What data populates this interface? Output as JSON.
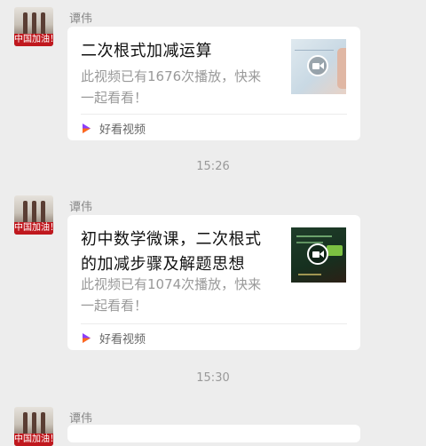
{
  "messages": [
    {
      "sender": "谭伟",
      "avatar_caption": "中国加油！",
      "card": {
        "title": "二次根式加减运算",
        "desc_line1": "此视频已有1676次播放，快来",
        "desc_line2": "一起看看！",
        "source_label": "好看视频"
      }
    },
    {
      "sender": "谭伟",
      "avatar_caption": "中国加油！",
      "card": {
        "title_line1": "初中数学微课，二次根式",
        "title_line2": "的加减步骤及解题思想",
        "desc_line1": "此视频已有1074次播放，快来",
        "desc_line2": "一起看看！",
        "source_label": "好看视频"
      }
    },
    {
      "sender": "谭伟",
      "avatar_caption": "中国加油！"
    }
  ],
  "timestamps": [
    "15:26",
    "15:30"
  ],
  "colors": {
    "background": "#ededed",
    "card": "#ffffff",
    "avatar_banner": "#c0181e",
    "source_icon_purple": "#8a3ffc",
    "source_icon_orange": "#ff6a1a"
  },
  "icons": {
    "play": "video-play-icon",
    "source": "haokan-video-icon"
  }
}
